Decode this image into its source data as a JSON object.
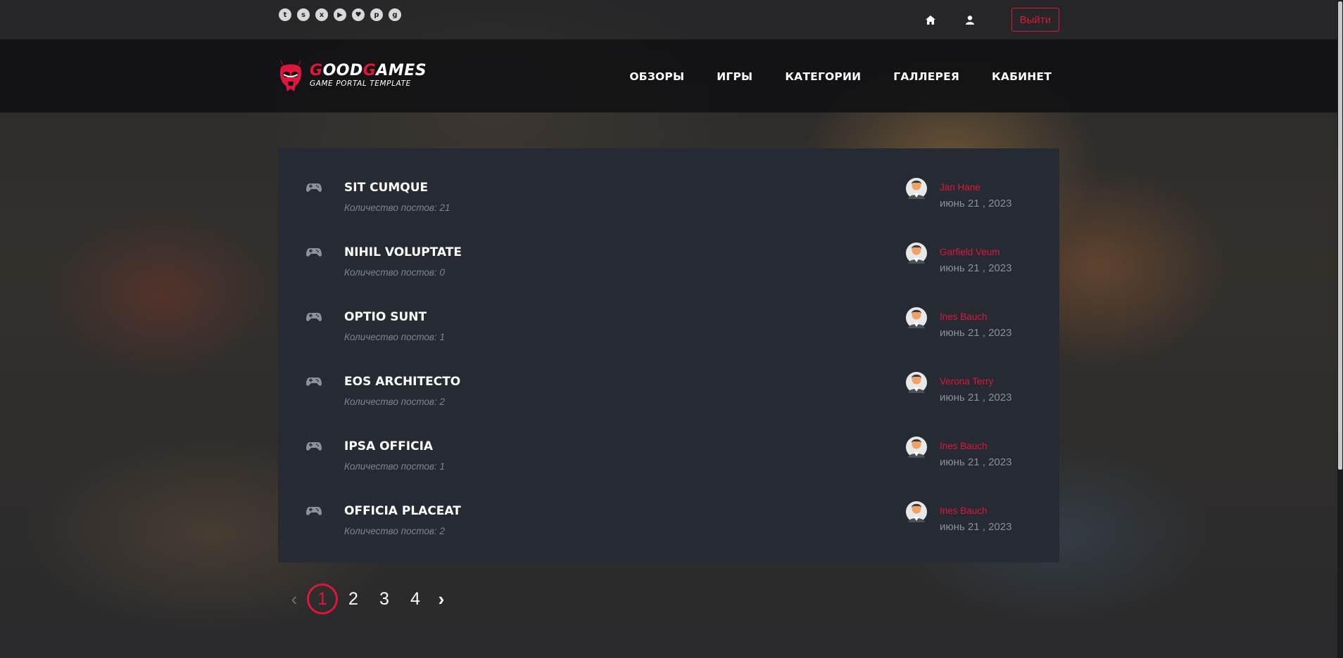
{
  "colors": {
    "accent": "#dd163b",
    "panel": "#252a33",
    "muted": "#8a919b"
  },
  "topbar": {
    "social_icons": [
      "twitch-icon",
      "steam-icon",
      "xbox-icon",
      "google-play-icon",
      "twitter-icon",
      "pinterest-icon",
      "github-icon"
    ],
    "logout_label": "Выйти"
  },
  "logo": {
    "title_red1": "G",
    "title_w1": "OOD",
    "title_red2": "G",
    "title_w2": "AMES",
    "subtitle": "GAME PORTAL TEMPLATE"
  },
  "nav": {
    "items": [
      "ОБЗОРЫ",
      "ИГРЫ",
      "КАТЕГОРИИ",
      "ГАЛЛЕРЕЯ",
      "КАБИНЕТ"
    ]
  },
  "topics": [
    {
      "title": "SIT CUMQUE",
      "count": "Количество постов: 21",
      "author": "Jan Hane",
      "date": "июнь 21 , 2023"
    },
    {
      "title": "NIHIL VOLUPTATE",
      "count": "Количество постов: 0",
      "author": "Garfield Veum",
      "date": "июнь 21 , 2023"
    },
    {
      "title": "OPTIO SUNT",
      "count": "Количество постов: 1",
      "author": "Ines Bauch",
      "date": "июнь 21 , 2023"
    },
    {
      "title": "EOS ARCHITECTO",
      "count": "Количество постов: 2",
      "author": "Verona Terry",
      "date": "июнь 21 , 2023"
    },
    {
      "title": "IPSA OFFICIA",
      "count": "Количество постов: 1",
      "author": "Ines Bauch",
      "date": "июнь 21 , 2023"
    },
    {
      "title": "OFFICIA PLACEAT",
      "count": "Количество постов: 2",
      "author": "Ines Bauch",
      "date": "июнь 21 , 2023"
    }
  ],
  "pagination": {
    "prev": "‹",
    "pages": [
      "1",
      "2",
      "3",
      "4"
    ],
    "next": "›",
    "current": "1"
  }
}
